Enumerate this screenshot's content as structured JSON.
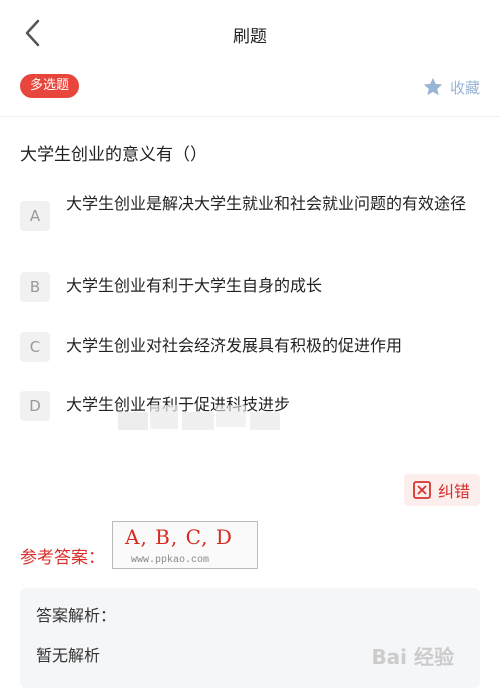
{
  "header": {
    "title": "刷题"
  },
  "question": {
    "type_badge": "多选题",
    "favorite_label": "收藏",
    "stem": "大学生创业的意义有（）",
    "options": [
      {
        "letter": "A",
        "text": "大学生创业是解决大学生就业和社会就业问题的有效途径"
      },
      {
        "letter": "B",
        "text": "大学生创业有利于大学生自身的成长"
      },
      {
        "letter": "C",
        "text": "大学生创业对社会经济发展具有积极的促进作用"
      },
      {
        "letter": "D",
        "text": "大学生创业有利于促进科技进步"
      }
    ]
  },
  "correction": {
    "label": "纠错"
  },
  "answer": {
    "label": "参考答案：",
    "value": "A, B, C, D",
    "watermark": "www.ppkao.com"
  },
  "analysis": {
    "title": "答案解析：",
    "body": "暂无解析"
  },
  "logo": {
    "text": "Bai 经验"
  },
  "colors": {
    "accent_red": "#e8453c",
    "answer_red": "#d8312b",
    "favorite_blue": "#9ab4d3"
  }
}
